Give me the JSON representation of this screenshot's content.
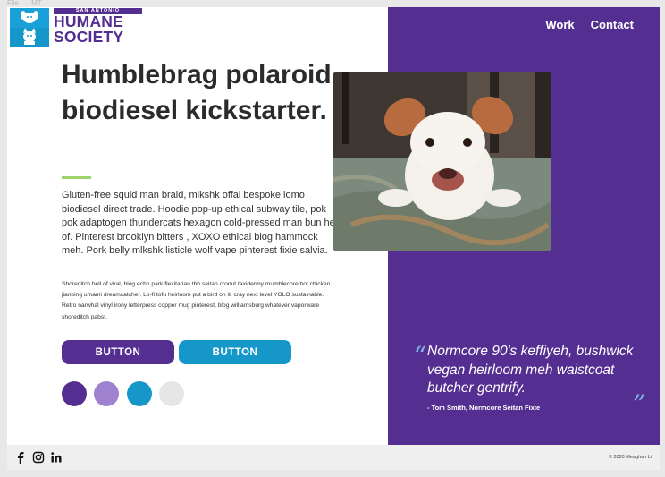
{
  "browser": {
    "tabs": [
      "File",
      "MT"
    ]
  },
  "brand": {
    "top_line": "SAN ANTONIO",
    "line1": "HUMANE",
    "line2": "SOCIETY"
  },
  "nav": {
    "items": [
      "Work",
      "Contact"
    ]
  },
  "hero": {
    "headline": "Humblebrag polaroid biodiesel kickstarter.",
    "lead": "Gluten-free squid man braid, mlkshk offal bespoke lomo biodiesel direct trade. Hoodie pop-up ethical subway tile, pok pok adaptogen thundercats hexagon cold-pressed man bun hell of. Pinterest brooklyn bitters , XOXO ethical blog hammock meh. Pork belly mlkshk listicle wolf vape pinterest fixie salvia.",
    "small_copy": "Shoreditch hell of viral, blog echo park flexitarian tbh seitan cronut taxidermy mumblecore hot chicken jianbing umami dreamcatcher. Lo-fi tofu heirloom put a bird on it, cray next level YOLO sustainable. Retro narwhal vinyl irony letterpress copper mug pinterest, blog williamsburg whatever vaporware shoreditch pabst.",
    "buttons": [
      "BUTTON",
      "BUTTON"
    ]
  },
  "swatches": [
    "#542e91",
    "#9f82cf",
    "#1598c9",
    "#e6e6e6"
  ],
  "colors": {
    "purple": "#542e91",
    "blue": "#1598c9",
    "green": "#9ed36a"
  },
  "testimonial": {
    "quote": "Normcore 90's keffiyeh, bushwick vegan heirloom meh waistcoat butcher gentrify.",
    "author": "- Tom Smith, Normcore Seitan Fixie",
    "open_mark": "“",
    "close_mark": "”"
  },
  "footer": {
    "social_icons": [
      "facebook-icon",
      "instagram-icon",
      "linkedin-icon"
    ],
    "copyright": "© 2020 Meaghan Li"
  }
}
